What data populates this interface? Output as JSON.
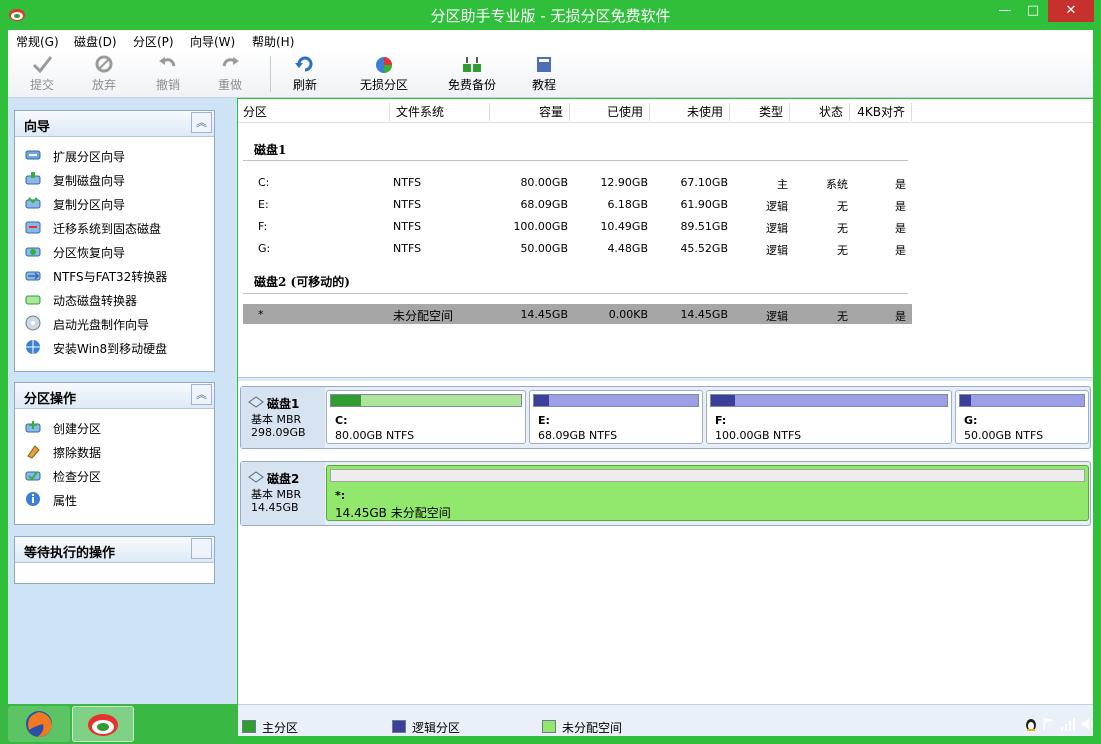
{
  "window": {
    "title": "分区助手专业版 - 无损分区免费软件"
  },
  "menu": [
    "常规(G)",
    "磁盘(D)",
    "分区(P)",
    "向导(W)",
    "帮助(H)"
  ],
  "toolbar": {
    "commit": "提交",
    "discard": "放弃",
    "undo": "撤销",
    "redo": "重做",
    "refresh": "刷新",
    "lossless": "无损分区",
    "backup": "免费备份",
    "tutorial": "教程"
  },
  "wizard": {
    "title": "向导",
    "items": [
      "扩展分区向导",
      "复制磁盘向导",
      "复制分区向导",
      "迁移系统到固态磁盘",
      "分区恢复向导",
      "NTFS与FAT32转换器",
      "动态磁盘转换器",
      "启动光盘制作向导",
      "安装Win8到移动硬盘"
    ]
  },
  "ops": {
    "title": "分区操作",
    "items": [
      "创建分区",
      "擦除数据",
      "检查分区",
      "属性"
    ]
  },
  "pending": {
    "title": "等待执行的操作"
  },
  "columns": [
    "分区",
    "文件系统",
    "容量",
    "已使用",
    "未使用",
    "类型",
    "状态",
    "4KB对齐"
  ],
  "disks": [
    {
      "title": "磁盘1",
      "rows": [
        {
          "part": "C:",
          "fs": "NTFS",
          "cap": "80.00GB",
          "used": "12.90GB",
          "free": "67.10GB",
          "type": "主",
          "status": "系统",
          "align": "是"
        },
        {
          "part": "E:",
          "fs": "NTFS",
          "cap": "68.09GB",
          "used": "6.18GB",
          "free": "61.90GB",
          "type": "逻辑",
          "status": "无",
          "align": "是"
        },
        {
          "part": "F:",
          "fs": "NTFS",
          "cap": "100.00GB",
          "used": "10.49GB",
          "free": "89.51GB",
          "type": "逻辑",
          "status": "无",
          "align": "是"
        },
        {
          "part": "G:",
          "fs": "NTFS",
          "cap": "50.00GB",
          "used": "4.48GB",
          "free": "45.52GB",
          "type": "逻辑",
          "status": "无",
          "align": "是"
        }
      ]
    },
    {
      "title": "磁盘2 (可移动的)",
      "rows": [
        {
          "part": "*",
          "fs": "未分配空间",
          "cap": "14.45GB",
          "used": "0.00KB",
          "free": "14.45GB",
          "type": "逻辑",
          "status": "无",
          "align": "是"
        }
      ]
    }
  ],
  "map": {
    "disk1": {
      "name": "磁盘1",
      "kind": "基本 MBR",
      "size": "298.09GB",
      "parts": [
        {
          "label": "C:",
          "desc": "80.00GB NTFS",
          "used_fraction": 0.16,
          "primary": true
        },
        {
          "label": "E:",
          "desc": "68.09GB NTFS",
          "used_fraction": 0.09,
          "primary": false
        },
        {
          "label": "F:",
          "desc": "100.00GB NTFS",
          "used_fraction": 0.1,
          "primary": false
        },
        {
          "label": "G:",
          "desc": "50.00GB NTFS",
          "used_fraction": 0.09,
          "primary": false
        }
      ]
    },
    "disk2": {
      "name": "磁盘2",
      "kind": "基本 MBR",
      "size": "14.45GB",
      "parts": [
        {
          "label": "*:",
          "desc": "14.45GB 未分配空间"
        }
      ]
    }
  },
  "legend": [
    "主分区",
    "逻辑分区",
    "未分配空间"
  ],
  "colors": {
    "primary": "#2f9d2f",
    "logical": "#3c3f9a",
    "unallocated": "#91e86c",
    "titlebar": "#2fbf3a"
  }
}
